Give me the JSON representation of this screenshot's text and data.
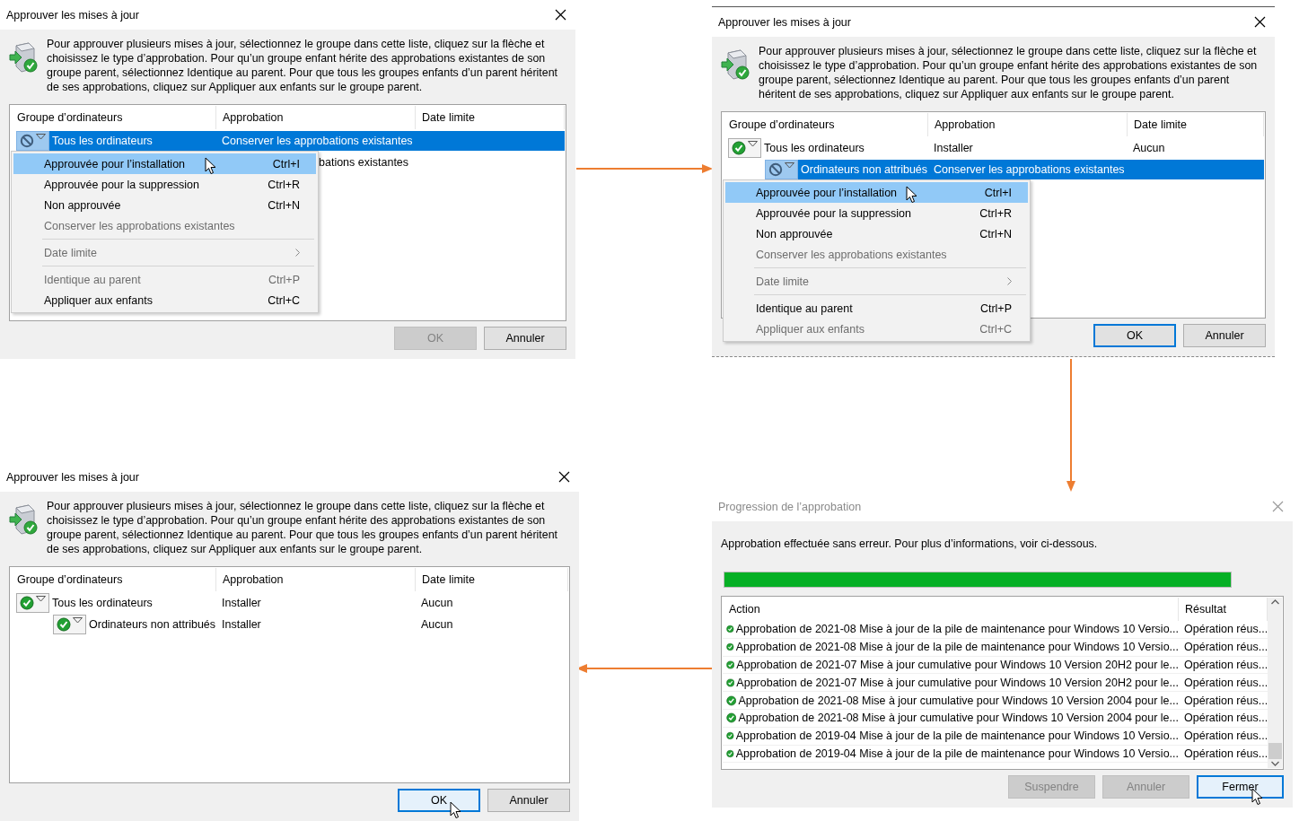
{
  "dialogs": [
    {
      "kind": "approve",
      "title": "Approuver les mises à jour",
      "active": true,
      "description": "Pour approuver plusieurs mises à jour, sélectionnez le groupe dans cette liste, cliquez sur la flèche et choisissez le type d’approbation. Pour qu’un groupe enfant hérite des approbations existantes de son groupe parent, sélectionnez Identique au parent. Pour que tous les groupes enfants d’un parent héritent de ses approbations, cliquez sur Appliquer aux enfants sur le groupe parent.",
      "columns": [
        "Groupe d’ordinateurs",
        "Approbation",
        "Date limite"
      ],
      "rows": [
        {
          "group": "Tous les ordinateurs",
          "approval": "Conserver les approbations existantes",
          "kind": "blocked",
          "selected": true,
          "menu_open": true,
          "children": [
            {
              "approval": "bations existantes",
              "kind": "covered"
            }
          ]
        }
      ],
      "menu": [
        {
          "kind": "item",
          "label": "Approuvée pour l’installation",
          "shortcut": "Ctrl+I",
          "disabled": false,
          "selected": true
        },
        {
          "kind": "item",
          "label": "Approuvée pour la suppression",
          "shortcut": "Ctrl+R",
          "disabled": false,
          "selected": false
        },
        {
          "kind": "item",
          "label": "Non approuvée",
          "shortcut": "Ctrl+N",
          "disabled": false,
          "selected": false
        },
        {
          "kind": "item",
          "label": "Conserver les approbations existantes",
          "disabled": true,
          "selected": false
        },
        {
          "kind": "separator"
        },
        {
          "kind": "submenu",
          "label": "Date limite",
          "disabled": true,
          "selected": false
        },
        {
          "kind": "separator"
        },
        {
          "kind": "item",
          "label": "Identique au parent",
          "shortcut": "Ctrl+P",
          "disabled": true,
          "selected": false
        },
        {
          "kind": "item",
          "label": "Appliquer aux enfants",
          "shortcut": "Ctrl+C",
          "disabled": false,
          "selected": false
        }
      ],
      "buttons": [
        {
          "label": "OK",
          "disabled": true,
          "default": false,
          "hovered": false
        },
        {
          "label": "Annuler",
          "disabled": false,
          "default": false,
          "hovered": false
        }
      ]
    },
    {
      "kind": "approve",
      "title": "Approuver les mises à jour",
      "active": true,
      "description": "Pour approuver plusieurs mises à jour, sélectionnez le groupe dans cette liste, cliquez sur la flèche et choisissez le type d’approbation. Pour qu’un groupe enfant hérite des approbations existantes de son groupe parent, sélectionnez Identique au parent. Pour que tous les groupes enfants d’un parent héritent de ses approbations, cliquez sur Appliquer aux enfants sur le groupe parent.",
      "columns": [
        "Groupe d’ordinateurs",
        "Approbation",
        "Date limite"
      ],
      "rows": [
        {
          "group": "Tous les ordinateurs",
          "approval": "Installer",
          "deadline": "Aucun",
          "kind": "approved",
          "selected": false,
          "menu_open": false,
          "children": [
            {
              "group": "Ordinateurs non attribués",
              "approval": "Conserver les approbations existantes",
              "kind": "blocked",
              "selected": true,
              "menu_open": true
            }
          ]
        }
      ],
      "menu": [
        {
          "kind": "item",
          "label": "Approuvée pour l’installation",
          "shortcut": "Ctrl+I",
          "disabled": false,
          "selected": true
        },
        {
          "kind": "item",
          "label": "Approuvée pour la suppression",
          "shortcut": "Ctrl+R",
          "disabled": false,
          "selected": false
        },
        {
          "kind": "item",
          "label": "Non approuvée",
          "shortcut": "Ctrl+N",
          "disabled": false,
          "selected": false
        },
        {
          "kind": "item",
          "label": "Conserver les approbations existantes",
          "disabled": true,
          "selected": false
        },
        {
          "kind": "separator"
        },
        {
          "kind": "submenu",
          "label": "Date limite",
          "disabled": true,
          "selected": false
        },
        {
          "kind": "separator"
        },
        {
          "kind": "item",
          "label": "Identique au parent",
          "shortcut": "Ctrl+P",
          "disabled": false,
          "selected": false
        },
        {
          "kind": "item",
          "label": "Appliquer aux enfants",
          "shortcut": "Ctrl+C",
          "disabled": true,
          "selected": false
        }
      ],
      "buttons": [
        {
          "label": "OK",
          "disabled": false,
          "default": true,
          "hovered": false
        },
        {
          "label": "Annuler",
          "disabled": false,
          "default": false,
          "hovered": false
        }
      ]
    },
    {
      "kind": "approve",
      "title": "Approuver les mises à jour",
      "active": true,
      "description": "Pour approuver plusieurs mises à jour, sélectionnez le groupe dans cette liste, cliquez sur la flèche et choisissez le type d’approbation. Pour qu’un groupe enfant hérite des approbations existantes de son groupe parent, sélectionnez Identique au parent. Pour que tous les groupes enfants d’un parent héritent de ses approbations, cliquez sur Appliquer aux enfants sur le groupe parent.",
      "columns": [
        "Groupe d’ordinateurs",
        "Approbation",
        "Date limite"
      ],
      "rows": [
        {
          "group": "Tous les ordinateurs",
          "approval": "Installer",
          "deadline": "Aucun",
          "kind": "approved",
          "selected": false,
          "children": [
            {
              "group": "Ordinateurs non attribués",
              "approval": "Installer",
              "deadline": "Aucun",
              "kind": "approved",
              "selected": false
            }
          ]
        }
      ],
      "buttons": [
        {
          "label": "OK",
          "disabled": false,
          "default": true,
          "hovered": true
        },
        {
          "label": "Annuler",
          "disabled": false,
          "default": false,
          "hovered": false
        }
      ]
    },
    {
      "kind": "progress",
      "title": "Progression de l’approbation",
      "active": false,
      "message": "Approbation effectuée sans erreur. Pour plus d’informations, voir ci-dessous.",
      "progress": {
        "level": 1
      },
      "columns": [
        "Action",
        "Résultat"
      ],
      "rows": [
        {
          "action": "Approbation de 2021-08 Mise à jour de la pile de maintenance pour Windows 10 Versio...",
          "result": "Opération réus..."
        },
        {
          "action": "Approbation de 2021-08 Mise à jour de la pile de maintenance pour Windows 10 Versio...",
          "result": "Opération réus..."
        },
        {
          "action": "Approbation de 2021-07 Mise à jour cumulative pour Windows 10 Version 20H2 pour le...",
          "result": "Opération réus..."
        },
        {
          "action": "Approbation de 2021-07 Mise à jour cumulative pour Windows 10 Version 20H2 pour le...",
          "result": "Opération réus..."
        },
        {
          "action": "Approbation de 2021-08 Mise à jour cumulative pour Windows 10 Version 2004 pour le...",
          "result": "Opération réus..."
        },
        {
          "action": "Approbation de 2021-08 Mise à jour cumulative pour Windows 10 Version 2004 pour le...",
          "result": "Opération réus..."
        },
        {
          "action": "Approbation de 2019-04 Mise à jour de la pile de maintenance pour Windows 10 Versio...",
          "result": "Opération réus..."
        },
        {
          "action": "Approbation de 2019-04 Mise à jour de la pile de maintenance pour Windows 10 Versio...",
          "result": "Opération réus..."
        }
      ],
      "buttons": [
        {
          "label": "Suspendre",
          "disabled": true,
          "default": false,
          "hovered": false
        },
        {
          "label": "Annuler",
          "disabled": true,
          "default": false,
          "hovered": false
        },
        {
          "label": "Fermer",
          "disabled": false,
          "default": true,
          "hovered": true
        }
      ]
    }
  ]
}
